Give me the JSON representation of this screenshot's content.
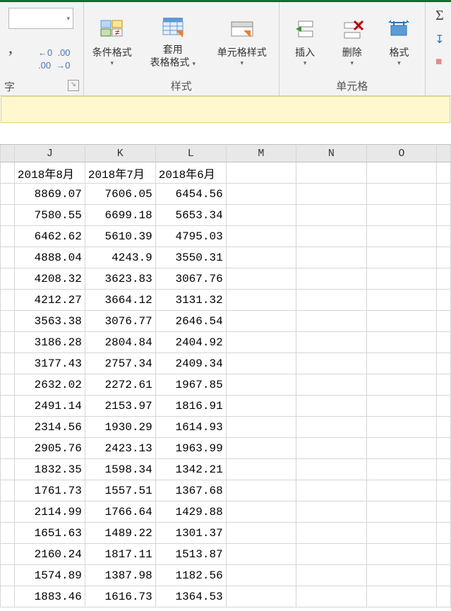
{
  "ribbon": {
    "style_dropdown": {
      "caret": "▾"
    },
    "number_group": {
      "inc_dec": "←0  .00",
      "dec_inc": ".00  →0",
      "label": "字",
      "launcher": "↘"
    },
    "styles": {
      "conditional": "条件格式",
      "table": "套用",
      "table2": "表格格式",
      "cell": "单元格样式",
      "label": "样式"
    },
    "cells": {
      "insert": "插入",
      "delete": "删除",
      "format": "格式",
      "label": "单元格"
    },
    "editing": {
      "sum": "Σ",
      "fill": "↧",
      "clear": "◆"
    }
  },
  "sheet": {
    "columns": [
      "J",
      "K",
      "L",
      "M",
      "N",
      "O"
    ],
    "headers": {
      "J": "2018年8月",
      "K": "2018年7月",
      "L": "2018年6月"
    },
    "rows": [
      {
        "J": "8869.07",
        "K": "7606.05",
        "L": "6454.56"
      },
      {
        "J": "7580.55",
        "K": "6699.18",
        "L": "5653.34"
      },
      {
        "J": "6462.62",
        "K": "5610.39",
        "L": "4795.03"
      },
      {
        "J": "4888.04",
        "K": "4243.9",
        "L": "3550.31"
      },
      {
        "J": "4208.32",
        "K": "3623.83",
        "L": "3067.76"
      },
      {
        "J": "4212.27",
        "K": "3664.12",
        "L": "3131.32"
      },
      {
        "J": "3563.38",
        "K": "3076.77",
        "L": "2646.54"
      },
      {
        "J": "3186.28",
        "K": "2804.84",
        "L": "2404.92"
      },
      {
        "J": "3177.43",
        "K": "2757.34",
        "L": "2409.34"
      },
      {
        "J": "2632.02",
        "K": "2272.61",
        "L": "1967.85"
      },
      {
        "J": "2491.14",
        "K": "2153.97",
        "L": "1816.91"
      },
      {
        "J": "2314.56",
        "K": "1930.29",
        "L": "1614.93"
      },
      {
        "J": "2905.76",
        "K": "2423.13",
        "L": "1963.99"
      },
      {
        "J": "1832.35",
        "K": "1598.34",
        "L": "1342.21"
      },
      {
        "J": "1761.73",
        "K": "1557.51",
        "L": "1367.68"
      },
      {
        "J": "2114.99",
        "K": "1766.64",
        "L": "1429.88"
      },
      {
        "J": "1651.63",
        "K": "1489.22",
        "L": "1301.37"
      },
      {
        "J": "2160.24",
        "K": "1817.11",
        "L": "1513.87"
      },
      {
        "J": "1574.89",
        "K": "1387.98",
        "L": "1182.56"
      },
      {
        "J": "1883.46",
        "K": "1616.73",
        "L": "1364.53"
      }
    ]
  }
}
